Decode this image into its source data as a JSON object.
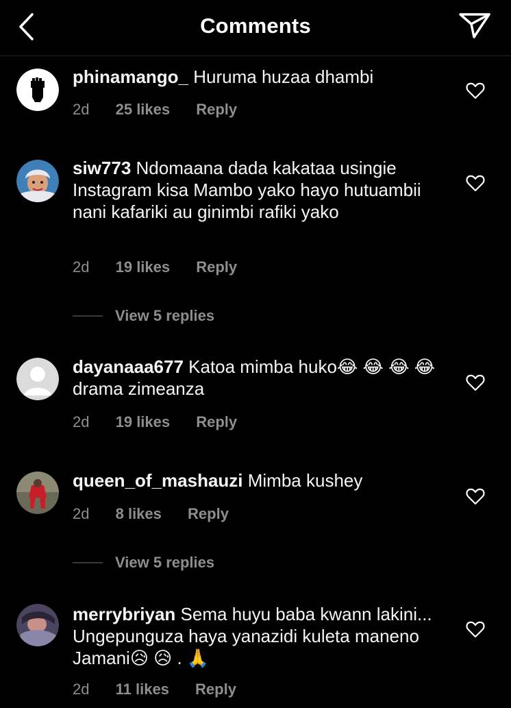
{
  "header": {
    "title": "Comments",
    "back_icon": "chevron-left-icon",
    "share_icon": "paper-plane-icon"
  },
  "comments": [
    {
      "username": "phinamango_",
      "text": "Huruma huzaa dhambi",
      "time": "2d",
      "likes": "25 likes",
      "reply": "Reply"
    },
    {
      "username": "siw773",
      "text": "Ndomaana dada kakataa usingie Instagram  kisa Mambo yako hayo hutuambii nani kafariki au ginimbi rafiki yako",
      "time": "2d",
      "likes": "19 likes",
      "reply": "Reply",
      "view_replies": "View 5 replies"
    },
    {
      "username": "dayanaaa677",
      "text": "Katoa mimba huko😂 😂 😂 😂drama zimeanza",
      "time": "2d",
      "likes": "19 likes",
      "reply": "Reply"
    },
    {
      "username": "queen_of_mashauzi",
      "text": "Mimba kushey",
      "time": "2d",
      "likes": "8 likes",
      "reply": "Reply",
      "view_replies": "View 5 replies"
    },
    {
      "username": "merrybriyan",
      "text": "Sema huyu baba kwann lakini... Ungepunguza haya yanazidi kuleta maneno Jamani😥 😥 . 🙏",
      "time": "2d",
      "likes": "11 likes",
      "reply": "Reply"
    }
  ],
  "colors": {
    "background": "#000000",
    "text": "#f5f5f5",
    "muted": "#8e8e8e",
    "divider": "#262626"
  },
  "icons": {
    "like": "heart-outline-icon"
  }
}
